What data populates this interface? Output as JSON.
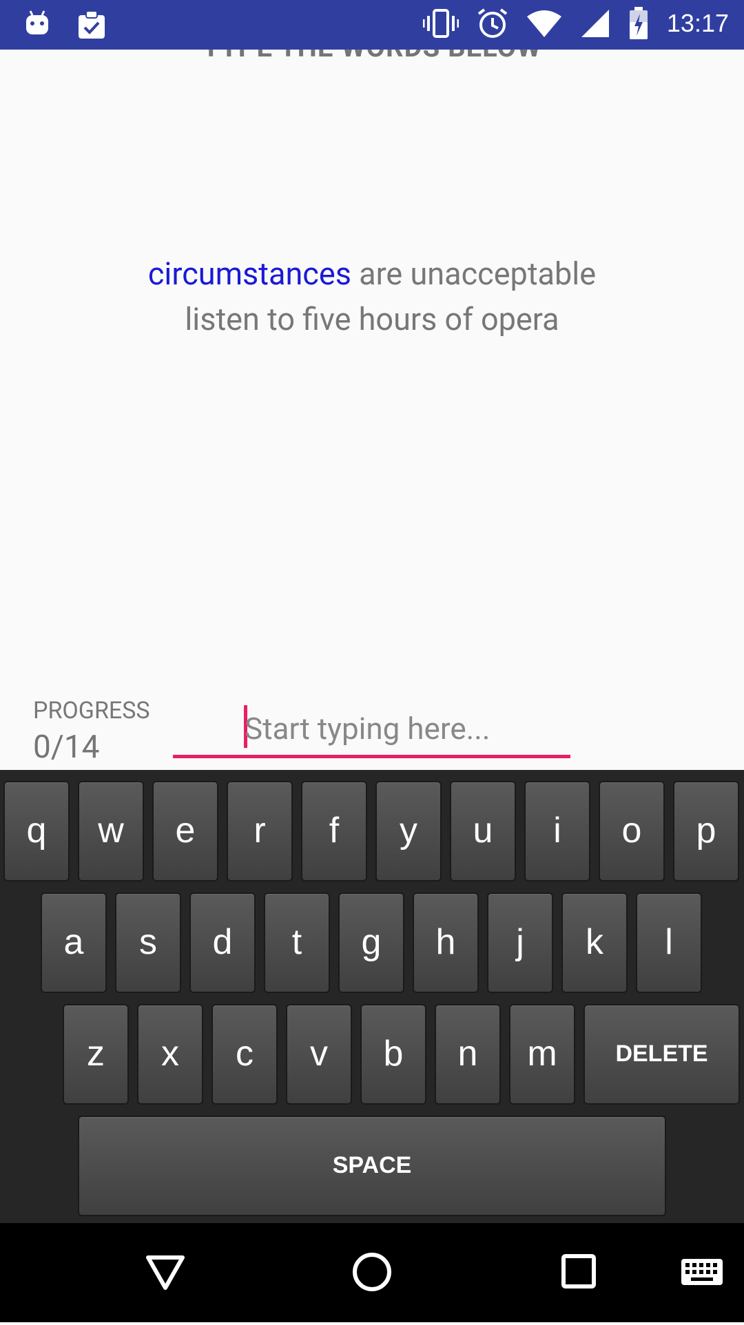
{
  "status_bar": {
    "time": "13:17",
    "left_icons": [
      "android-icon",
      "clipboard-check-icon"
    ],
    "right_icons": [
      "vibrate-icon",
      "alarm-icon",
      "wifi-icon",
      "signal-icon",
      "battery-icon"
    ],
    "color": "#303f9f"
  },
  "header": {
    "title": "TYPE THE WORDS BELOW"
  },
  "sentence": {
    "current_word": "circumstances",
    "rest_line1": " are unacceptable",
    "line2": "listen to five hours of opera",
    "current_word_color": "#1a1ad6"
  },
  "progress": {
    "label": "PROGRESS",
    "value": "0/14"
  },
  "input": {
    "placeholder": "Start typing here...",
    "accent_color": "#e91e63"
  },
  "keyboard": {
    "row1": [
      "q",
      "w",
      "e",
      "r",
      "f",
      "y",
      "u",
      "i",
      "o",
      "p"
    ],
    "row2": [
      "a",
      "s",
      "d",
      "t",
      "g",
      "h",
      "j",
      "k",
      "l"
    ],
    "row3": [
      "z",
      "x",
      "c",
      "v",
      "b",
      "n",
      "m"
    ],
    "delete_label": "DELETE",
    "space_label": "SPACE"
  },
  "nav_bar": {
    "buttons": [
      "back-icon",
      "home-icon",
      "recents-icon",
      "keyboard-switch-icon"
    ]
  }
}
